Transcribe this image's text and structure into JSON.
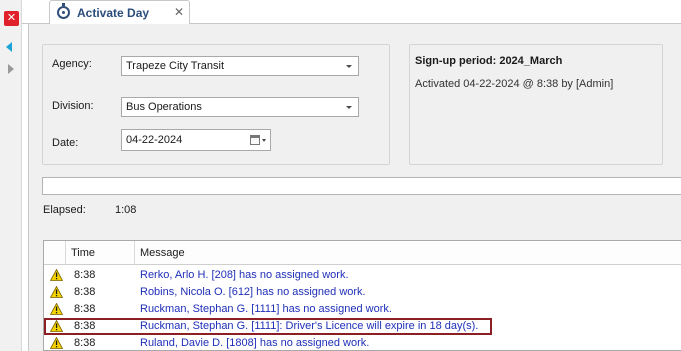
{
  "tab": {
    "title": "Activate Day",
    "close_glyph": "✕"
  },
  "side": {
    "close_glyph": "✕"
  },
  "form": {
    "agency_label": "Agency:",
    "agency_value": "Trapeze City Transit",
    "division_label": "Division:",
    "division_value": "Bus Operations",
    "date_label": "Date:",
    "date_value": "04-22-2024"
  },
  "signup": {
    "title": "Sign-up period: 2024_March",
    "activated": "Activated 04-22-2024 @  8:38 by [Admin]"
  },
  "progress": {
    "fraction": 0
  },
  "elapsed": {
    "label": "Elapsed:",
    "value": "1:08"
  },
  "grid": {
    "headers": {
      "time": "Time",
      "message": "Message"
    },
    "rows": [
      {
        "time": "8:38",
        "message": "Rerko, Arlo H. [208] has no assigned work.",
        "icon": "warning-icon"
      },
      {
        "time": "8:38",
        "message": "Robins, Nicola O. [612] has no assigned work.",
        "icon": "warning-icon"
      },
      {
        "time": "8:38",
        "message": "Ruckman, Stephan G. [1111] has no assigned work.",
        "icon": "warning-icon"
      },
      {
        "time": "8:38",
        "message": "Ruckman, Stephan G. [1111]: Driver's Licence will expire in 18 day(s).",
        "icon": "warning-icon"
      },
      {
        "time": "8:38",
        "message": "Ruland, Davie D. [1808] has no assigned work.",
        "icon": "warning-icon"
      }
    ]
  },
  "colors": {
    "message_text": "#1f2fb8",
    "highlight_border": "#8b1f24",
    "warning_fill": "#f5d300"
  }
}
